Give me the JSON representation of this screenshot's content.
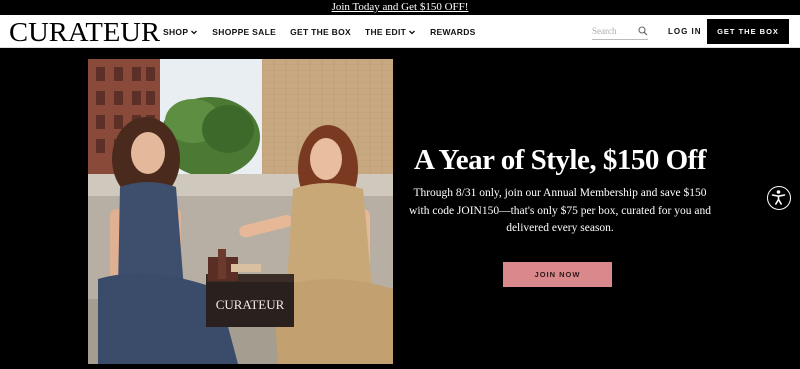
{
  "announcement": {
    "text": "Join Today and Get $150 OFF!"
  },
  "header": {
    "logo": "CURATEUR",
    "nav": [
      {
        "label": "SHOP",
        "has_dropdown": true
      },
      {
        "label": "SHOPPE SALE",
        "has_dropdown": false
      },
      {
        "label": "GET THE BOX",
        "has_dropdown": false
      },
      {
        "label": "THE EDIT",
        "has_dropdown": true
      },
      {
        "label": "REWARDS",
        "has_dropdown": false
      }
    ],
    "search": {
      "placeholder": "Search",
      "icon": "search-icon"
    },
    "login_label": "LOG IN",
    "get_box_label": "GET THE BOX"
  },
  "hero": {
    "title": "A Year of Style, $150 Off",
    "subtitle": "Through 8/31 only, join our Annual Membership and save $150 with code JOIN150—that's only $75 per box, curated for you and delivered every season.",
    "cta_label": "JOIN NOW",
    "box_brand_text": "CURATEUR"
  },
  "colors": {
    "background": "#000000",
    "cta": "#d9898b",
    "header_bg": "#ffffff"
  },
  "accessibility": {
    "icon": "accessibility-icon"
  }
}
